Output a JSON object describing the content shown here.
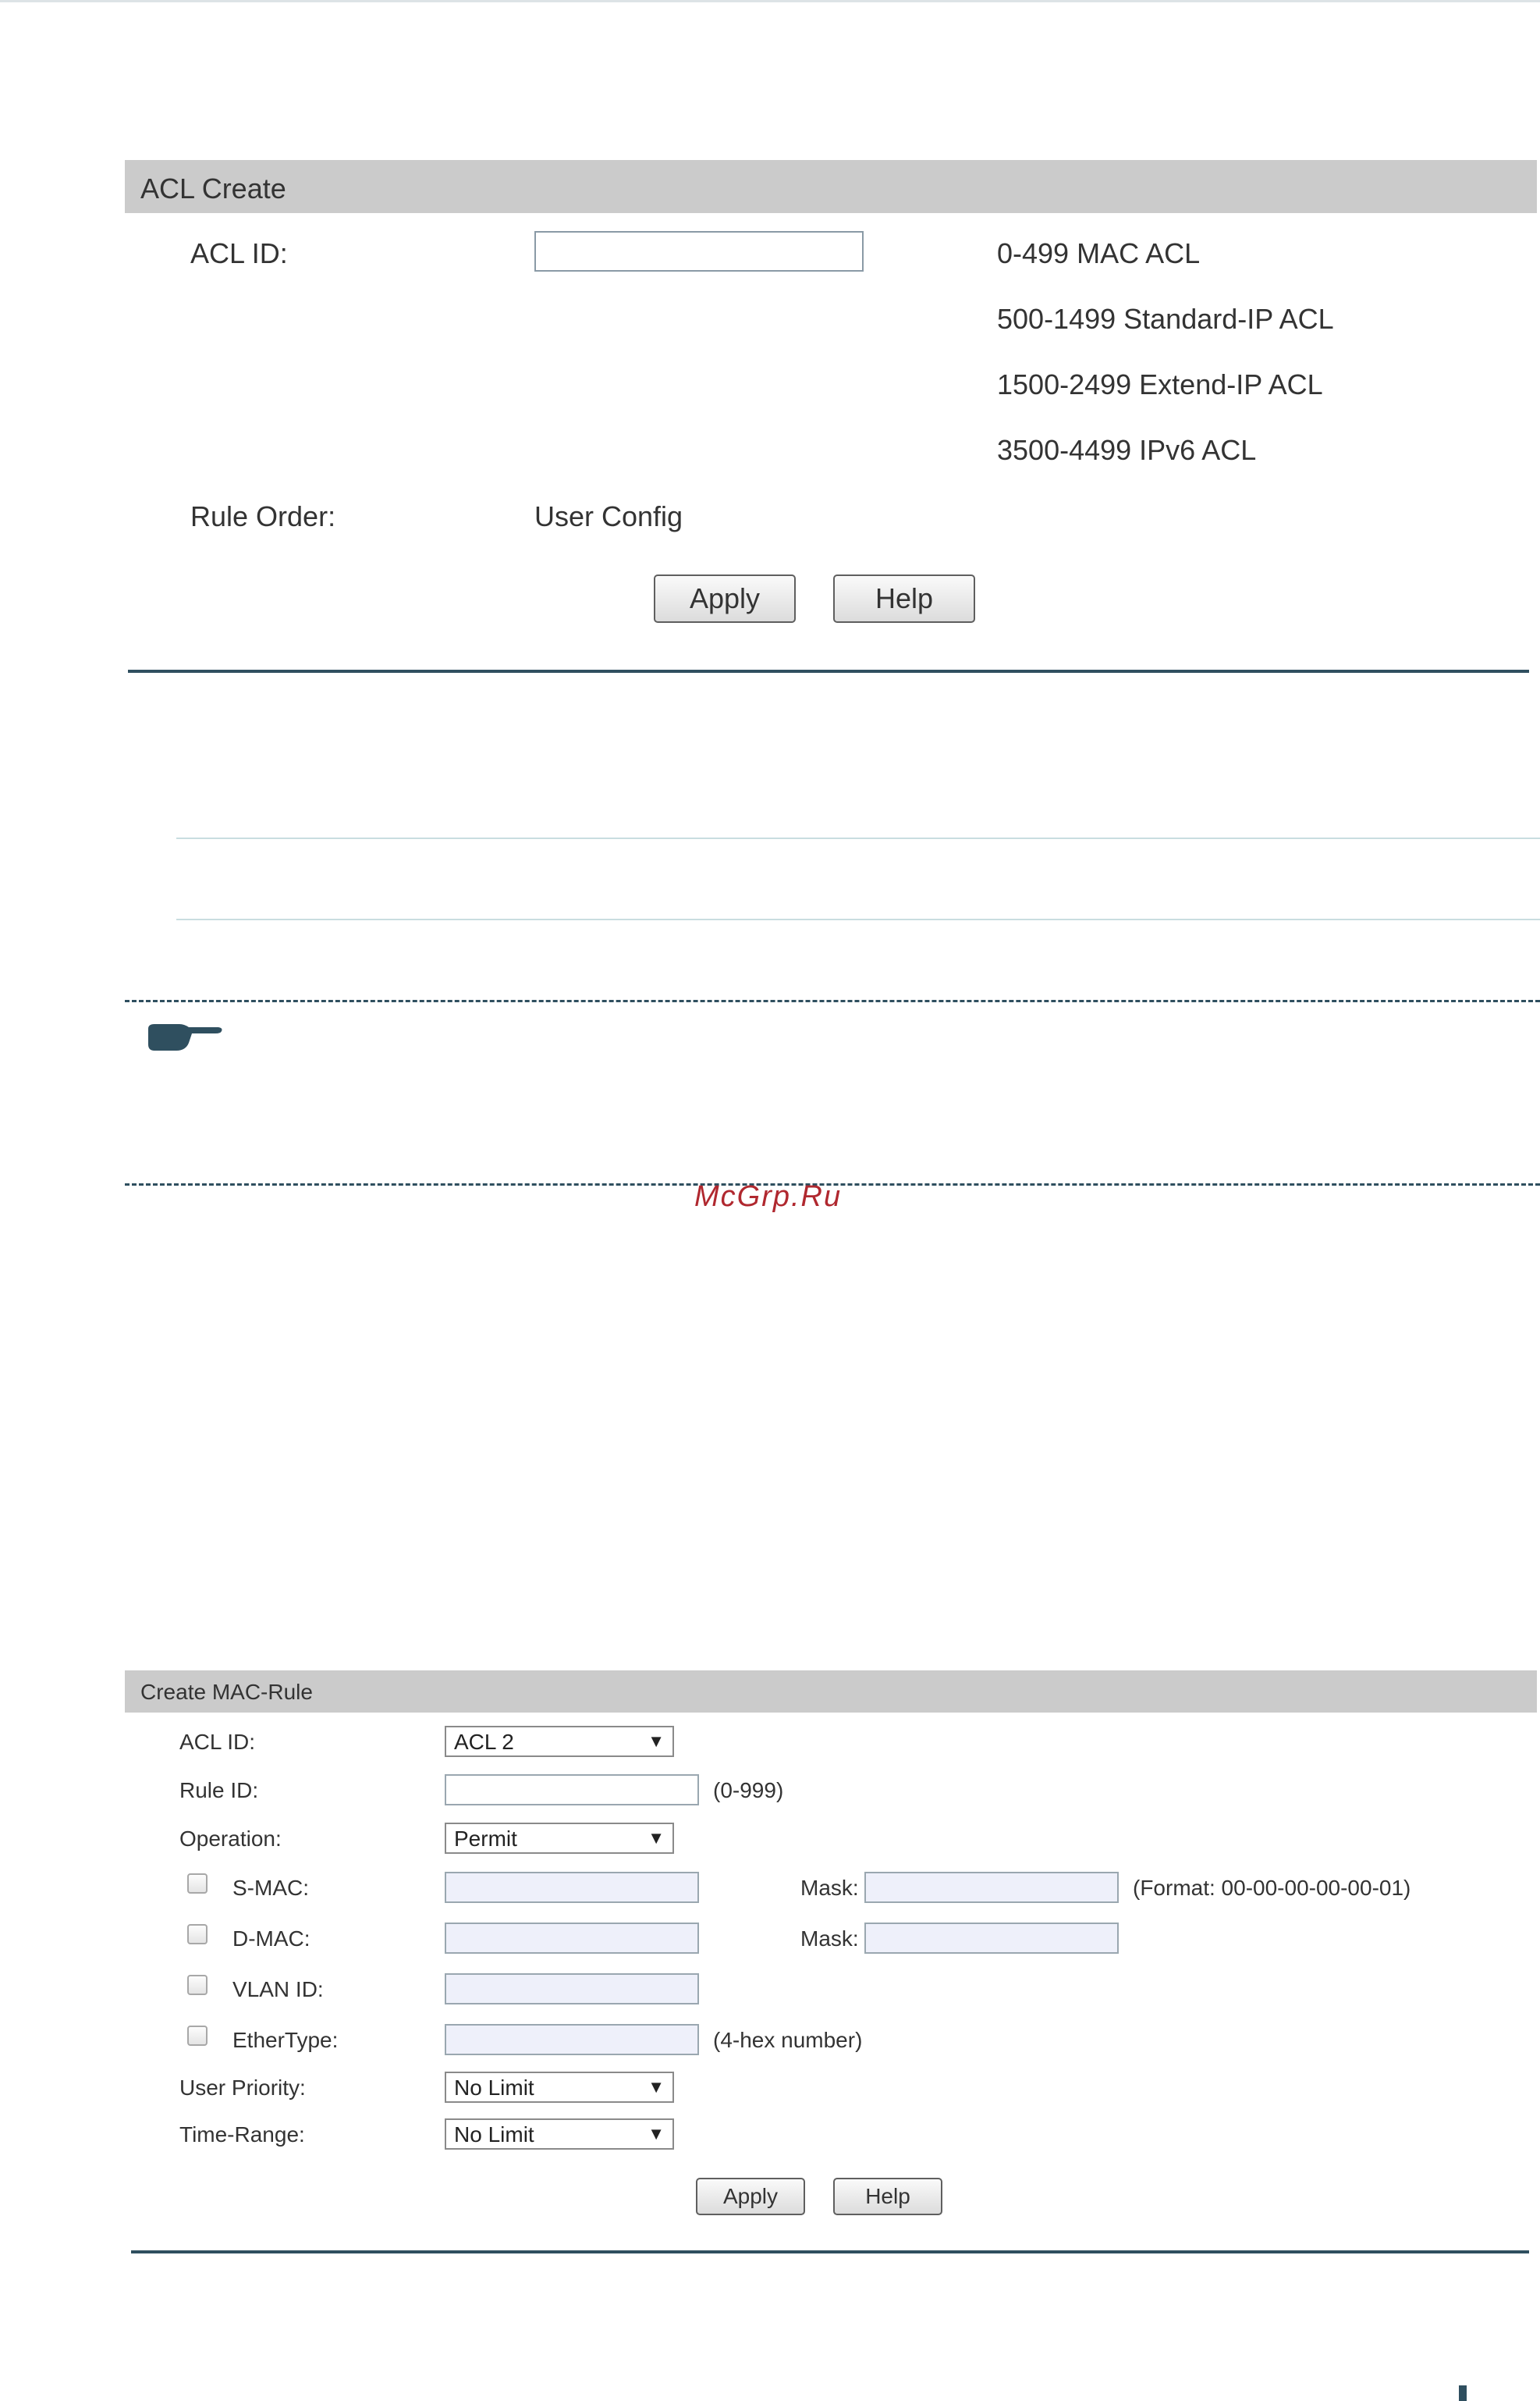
{
  "acl_create": {
    "title": "ACL Create",
    "acl_id_label": "ACL ID:",
    "acl_id_value": "",
    "ranges": [
      "0-499 MAC ACL",
      "500-1499 Standard-IP ACL",
      "1500-2499 Extend-IP ACL",
      "3500-4499 IPv6 ACL"
    ],
    "rule_order_label": "Rule Order:",
    "rule_order_value": "User Config",
    "apply_label": "Apply",
    "help_label": "Help"
  },
  "watermark": "McGrp.Ru",
  "mac_rule": {
    "title": "Create MAC-Rule",
    "acl_id_label": "ACL ID:",
    "acl_id_value": "ACL 2",
    "rule_id_label": "Rule ID:",
    "rule_id_value": "",
    "rule_id_hint": "(0-999)",
    "operation_label": "Operation:",
    "operation_value": "Permit",
    "smac_label": "S-MAC:",
    "smac_mask_label": "Mask:",
    "smac_hint": "(Format: 00-00-00-00-00-01)",
    "dmac_label": "D-MAC:",
    "dmac_mask_label": "Mask:",
    "vlan_label": "VLAN ID:",
    "ethertype_label": "EtherType:",
    "ethertype_hint": "(4-hex number)",
    "user_priority_label": "User Priority:",
    "user_priority_value": "No Limit",
    "time_range_label": "Time-Range:",
    "time_range_value": "No Limit",
    "apply_label": "Apply",
    "help_label": "Help"
  },
  "colors": {
    "header_bar": "#cbcbcb",
    "rule_dark": "#2f4f5f",
    "rule_light": "#c9dde0",
    "watermark": "#b0282f",
    "input_fill": "#eef0fa"
  },
  "icons": {
    "note": "pointing-hand-icon",
    "dropdown": "triangle-down-icon"
  }
}
